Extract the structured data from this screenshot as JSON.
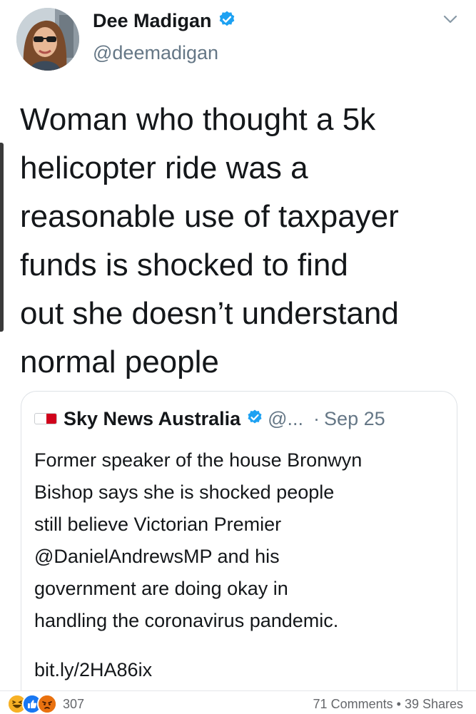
{
  "tweet": {
    "author_name": "Dee Madigan",
    "author_handle": "@deemadigan",
    "text": "Woman who thought a 5k\nhelicopter ride was a\nreasonable use of taxpayer\nfunds is shocked to find\nout she doesn’t understand\nnormal people"
  },
  "quoted_tweet": {
    "author_name": "Sky News Australia",
    "author_handle": "@...",
    "separator": "·",
    "date": "Sep 25",
    "text": "Former speaker of the house Bronwyn\nBishop says she is shocked people\nstill believe Victorian Premier\n@DanielAndrewsMP and his\ngovernment are doing okay in\nhandling the coronavirus pandemic.",
    "link": "bit.ly/2HA86ix"
  },
  "post_footer": {
    "reaction_count": "307",
    "comments": "71 Comments",
    "dot": "•",
    "shares": "39 Shares"
  },
  "icons": {
    "verified": "verified-badge-icon",
    "chevron": "chevron-down-icon",
    "reactions": [
      "haha-reaction-icon",
      "like-reaction-icon",
      "angry-reaction-icon"
    ]
  },
  "colors": {
    "verified": "#1da1f2",
    "handle": "#657786",
    "like": "#1877f2",
    "haha": "#f7b125",
    "angry": "#e9710f"
  }
}
